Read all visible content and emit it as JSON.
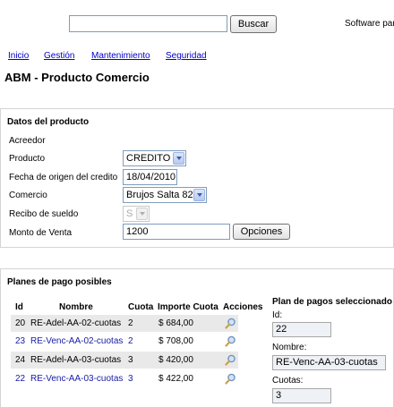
{
  "search": {
    "value": "",
    "button_label": "Buscar"
  },
  "header": {
    "tagline": "Software par"
  },
  "nav": {
    "items": [
      "Inicio",
      "Gestión",
      "Mantenimiento",
      "Seguridad"
    ]
  },
  "page": {
    "title": "ABM - Producto Comercio"
  },
  "product_section": {
    "title": "Datos del producto",
    "acreedor_label": "Acreedor",
    "producto_label": "Producto",
    "producto_value": "CREDITO",
    "fecha_label": "Fecha de origen del credito",
    "fecha_value": "18/04/2010",
    "comercio_label": "Comercio",
    "comercio_value": "Brujos Salta 82",
    "recibo_label": "Recibo de sueldo",
    "recibo_value": "S",
    "monto_label": "Monto de Venta",
    "monto_value": "1200",
    "opciones_label": "Opciones"
  },
  "plans_section": {
    "title": "Planes de pago posibles",
    "columns": [
      "Id",
      "Nombre",
      "Cuota",
      "Importe Cuota",
      "Acciones"
    ],
    "rows": [
      {
        "id": "20",
        "nombre": "RE-Adel-AA-02-cuotas",
        "cuota": "2",
        "importe": "$ 684,00"
      },
      {
        "id": "23",
        "nombre": "RE-Venc-AA-02-cuotas",
        "cuota": "2",
        "importe": "$ 708,00"
      },
      {
        "id": "24",
        "nombre": "RE-Adel-AA-03-cuotas",
        "cuota": "3",
        "importe": "$ 420,00"
      },
      {
        "id": "22",
        "nombre": "RE-Venc-AA-03-cuotas",
        "cuota": "3",
        "importe": "$ 422,00"
      }
    ]
  },
  "selected_plan": {
    "title": "Plan de pagos seleccionado",
    "id_label": "Id:",
    "id_value": "22",
    "nombre_label": "Nombre:",
    "nombre_value": "RE-Venc-AA-03-cuotas",
    "cuotas_label": "Cuotas:",
    "cuotas_value": "3"
  },
  "icons": {
    "action": "magnifier-icon",
    "dropdown": "chevron-down-icon"
  },
  "colors": {
    "link": "#0000cc",
    "table_link": "#1a1aa6",
    "row_alt": "#e9e9e9"
  }
}
